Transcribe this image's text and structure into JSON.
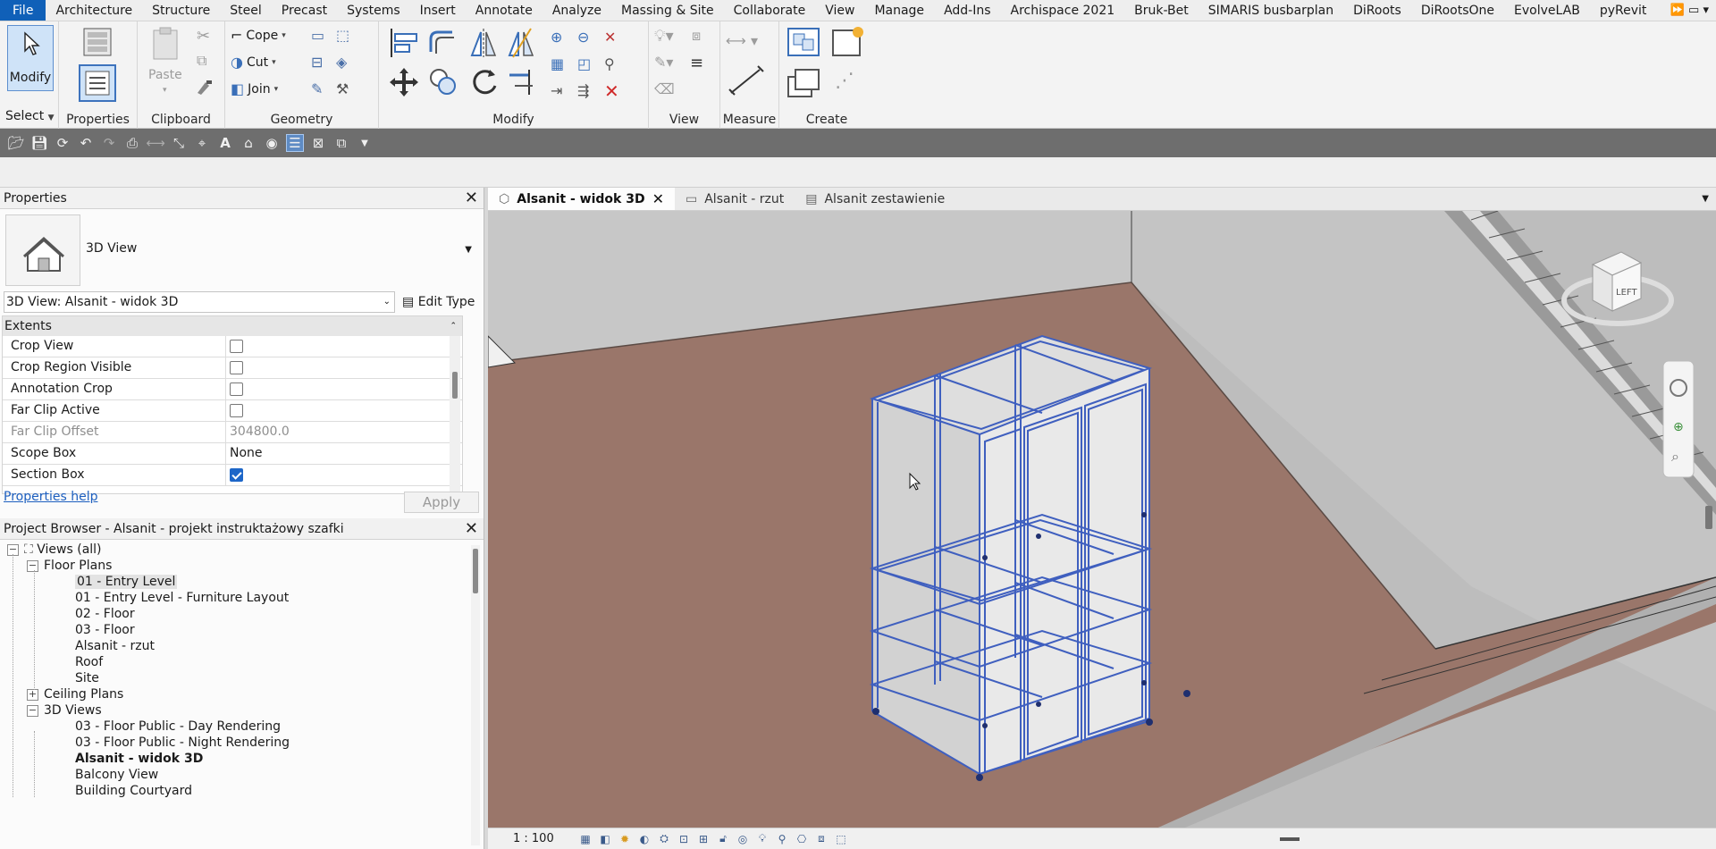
{
  "menubar": {
    "items": [
      "File",
      "Architecture",
      "Structure",
      "Steel",
      "Precast",
      "Systems",
      "Insert",
      "Annotate",
      "Analyze",
      "Massing & Site",
      "Collaborate",
      "View",
      "Manage",
      "Add-Ins",
      "Archispace 2021",
      "Bruk-Bet",
      "SIMARIS busbarplan",
      "DiRoots",
      "DiRootsOne",
      "EvolveLAB",
      "pyRevit"
    ],
    "overflow": "⏩  ▭ ▾"
  },
  "ribbon": {
    "modify_label": "Modify",
    "select_label": "Select",
    "properties_label": "Properties",
    "clipboard_label": "Clipboard",
    "paste_label": "Paste",
    "geometry_label": "Geometry",
    "cope_label": "Cope",
    "cut_label": "Cut",
    "join_label": "Join",
    "modify_panel_label": "Modify",
    "view_label": "View",
    "measure_label": "Measure",
    "create_label": "Create"
  },
  "properties": {
    "title": "Properties",
    "type_name": "3D View",
    "instance_selector": "3D View: Alsanit - widok 3D",
    "edit_type": "Edit Type",
    "section": "Extents",
    "rows": [
      {
        "key": "Crop View",
        "type": "checkbox",
        "checked": false,
        "disabled": false
      },
      {
        "key": "Crop Region Visible",
        "type": "checkbox",
        "checked": false,
        "disabled": false
      },
      {
        "key": "Annotation Crop",
        "type": "checkbox",
        "checked": false,
        "disabled": false
      },
      {
        "key": "Far Clip Active",
        "type": "checkbox",
        "checked": false,
        "disabled": false
      },
      {
        "key": "Far Clip Offset",
        "type": "text",
        "value": "304800.0",
        "disabled": true
      },
      {
        "key": "Scope Box",
        "type": "text",
        "value": "None",
        "disabled": false
      },
      {
        "key": "Section Box",
        "type": "checkbox",
        "checked": true,
        "disabled": false
      }
    ],
    "help_link": "Properties help",
    "apply": "Apply"
  },
  "project_browser": {
    "title": "Project Browser - Alsanit - projekt instruktażowy szafki",
    "tree": [
      {
        "label": "Views (all)",
        "level": 0,
        "expander": "−",
        "icon": true
      },
      {
        "label": "Floor Plans",
        "level": 1,
        "expander": "−"
      },
      {
        "label": "01 - Entry Level",
        "level": 2,
        "selected": true
      },
      {
        "label": "01 - Entry Level - Furniture Layout",
        "level": 2
      },
      {
        "label": "02 - Floor",
        "level": 2
      },
      {
        "label": "03 - Floor",
        "level": 2
      },
      {
        "label": "Alsanit - rzut",
        "level": 2
      },
      {
        "label": "Roof",
        "level": 2
      },
      {
        "label": "Site",
        "level": 2
      },
      {
        "label": "Ceiling Plans",
        "level": 1,
        "expander": "+"
      },
      {
        "label": "3D Views",
        "level": 1,
        "expander": "−"
      },
      {
        "label": "03 - Floor Public - Day Rendering",
        "level": 2
      },
      {
        "label": "03 - Floor Public - Night Rendering",
        "level": 2
      },
      {
        "label": "Alsanit - widok 3D",
        "level": 2,
        "bold": true
      },
      {
        "label": "Balcony View",
        "level": 2
      },
      {
        "label": "Building Courtyard",
        "level": 2
      }
    ]
  },
  "tabs": [
    {
      "label": "Alsanit - widok 3D",
      "active": true,
      "closable": true,
      "icon": "cube-icon"
    },
    {
      "label": "Alsanit - rzut",
      "active": false,
      "icon": "plan-icon"
    },
    {
      "label": "Alsanit zestawienie",
      "active": false,
      "icon": "schedule-icon"
    }
  ],
  "viewcube_face": "LEFT",
  "status": {
    "scale": "1 : 100"
  },
  "colors": {
    "accent": "#1060b8",
    "floor": "#9a766a",
    "cabinet_edge": "#3f5fbf"
  }
}
